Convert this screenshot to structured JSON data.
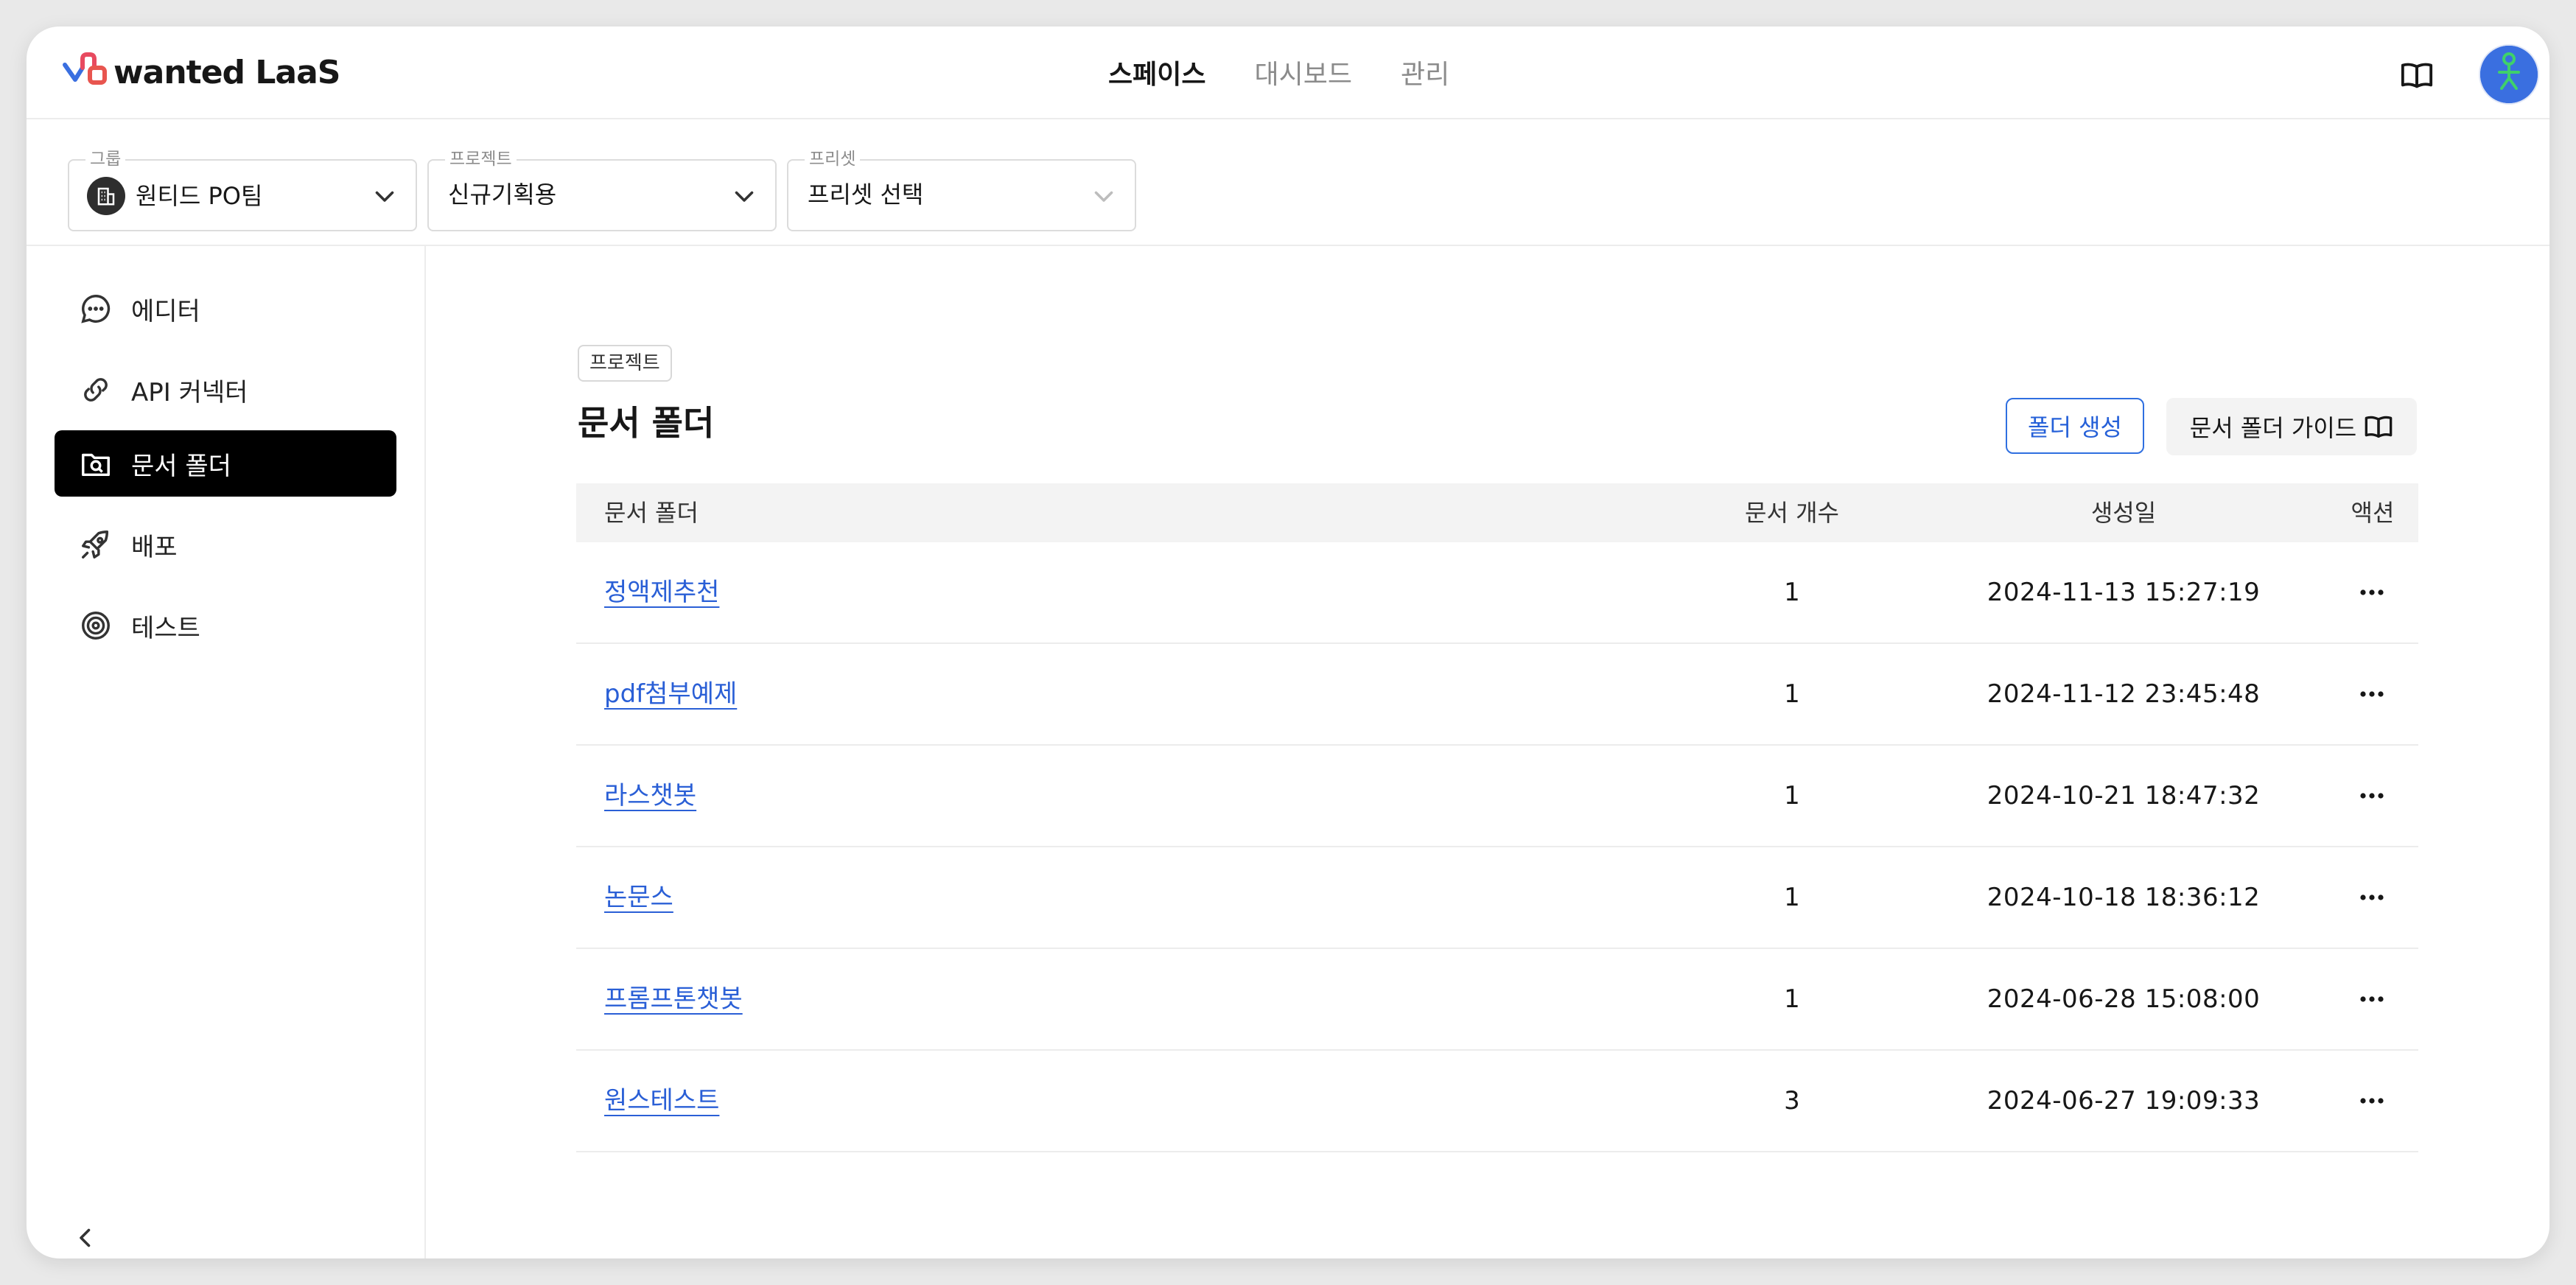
{
  "app": {
    "logo_text": "wanted LaaS"
  },
  "topnav": [
    {
      "label": "스페이스",
      "active": true
    },
    {
      "label": "대시보드",
      "active": false
    },
    {
      "label": "관리",
      "active": false
    }
  ],
  "selectors": {
    "group": {
      "label": "그룹",
      "value": "원티드 PO팀"
    },
    "project": {
      "label": "프로젝트",
      "value": "신규기획용"
    },
    "preset": {
      "label": "프리셋",
      "value": "프리셋 선택"
    }
  },
  "sidebar": {
    "items": [
      {
        "label": "에디터",
        "icon": "chat-bubble-icon",
        "active": false
      },
      {
        "label": "API 커넥터",
        "icon": "link-icon",
        "active": false
      },
      {
        "label": "문서 폴더",
        "icon": "folder-search-icon",
        "active": true
      },
      {
        "label": "배포",
        "icon": "rocket-icon",
        "active": false
      },
      {
        "label": "테스트",
        "icon": "target-icon",
        "active": false
      }
    ]
  },
  "main": {
    "tag": "프로젝트",
    "title": "문서 폴더",
    "create_button": "폴더 생성",
    "guide_button": "문서 폴더 가이드"
  },
  "table": {
    "headers": {
      "name": "문서 폴더",
      "count": "문서 개수",
      "created": "생성일",
      "action": "액션"
    },
    "rows": [
      {
        "name": "정액제추천",
        "count": "1",
        "created": "2024-11-13 15:27:19"
      },
      {
        "name": "pdf첨부예제",
        "count": "1",
        "created": "2024-11-12 23:45:48"
      },
      {
        "name": "라스챗봇",
        "count": "1",
        "created": "2024-10-21 18:47:32"
      },
      {
        "name": "논문스",
        "count": "1",
        "created": "2024-10-18 18:36:12"
      },
      {
        "name": "프롬프톤챗봇",
        "count": "1",
        "created": "2024-06-28 15:08:00"
      },
      {
        "name": "원스테스트",
        "count": "3",
        "created": "2024-06-27 19:09:33"
      }
    ]
  },
  "colors": {
    "accent": "#2560d8",
    "active_sidebar_bg": "#000000",
    "avatar_bg": "#3a6fe0",
    "avatar_figure": "#3fd16a"
  }
}
